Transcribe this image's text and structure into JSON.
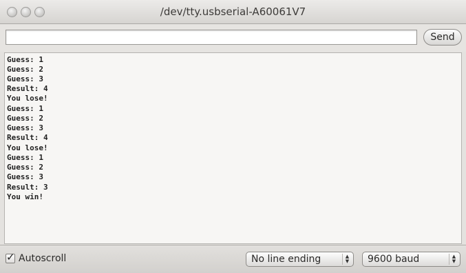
{
  "window": {
    "title": "/dev/tty.usbserial-A60061V7"
  },
  "input": {
    "value": "",
    "send_label": "Send"
  },
  "output": {
    "lines": [
      "Guess: 1",
      "Guess: 2",
      "Guess: 3",
      "Result: 4",
      "You lose!",
      "Guess: 1",
      "Guess: 2",
      "Guess: 3",
      "Result: 4",
      "You lose!",
      "Guess: 1",
      "Guess: 2",
      "Guess: 3",
      "Result: 3",
      "You win!"
    ]
  },
  "footer": {
    "autoscroll_label": "Autoscroll",
    "autoscroll_checked": true,
    "line_ending": "No line ending",
    "baud_rate": "9600 baud"
  },
  "icons": {
    "close": "close-button-icon",
    "minimize": "minimize-button-icon",
    "zoom": "zoom-button-icon",
    "check": "checkmark-icon",
    "select_arrows": "up-down-arrows-icon"
  }
}
